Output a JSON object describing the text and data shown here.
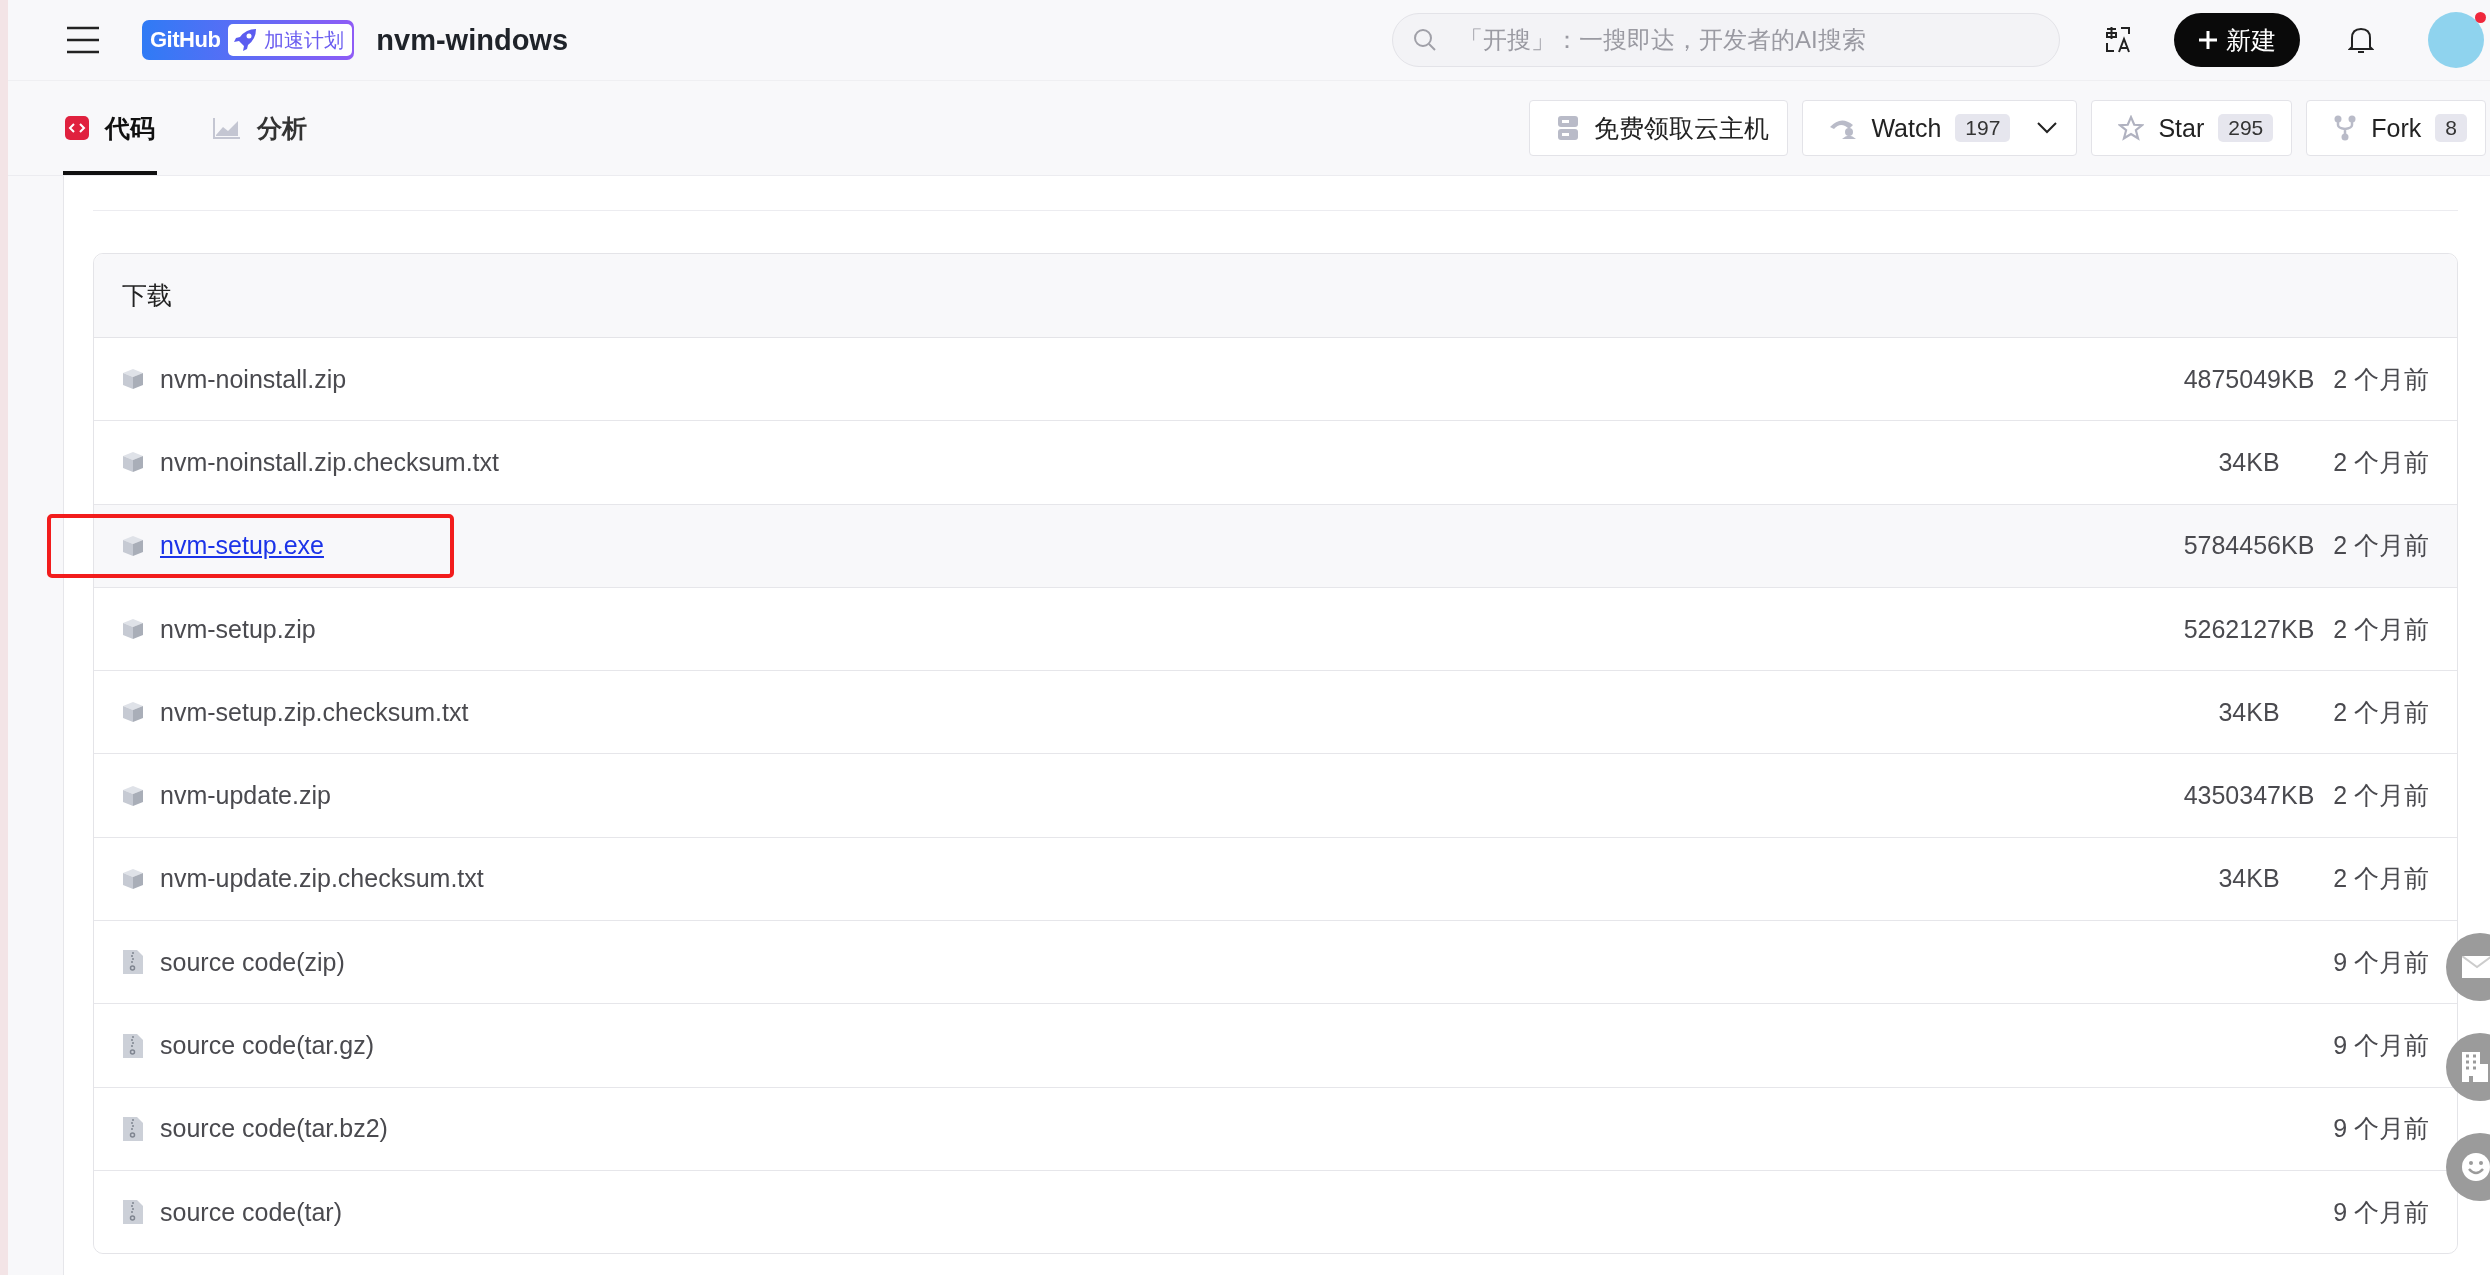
{
  "header": {
    "brand": {
      "logo": "GitHub",
      "program": "加速计划"
    },
    "repo_name": "nvm-windows",
    "search": {
      "placeholder": "「开搜」：一搜即达，开发者的AI搜索"
    },
    "new_button": "新建",
    "has_notification": true
  },
  "tabs": [
    {
      "kind": "code",
      "label": "代码",
      "selected": true
    },
    {
      "kind": "chart",
      "label": "分析",
      "selected": false
    }
  ],
  "actions": [
    {
      "kind": "cloud",
      "label": "免费领取云主机"
    },
    {
      "kind": "watch",
      "label": "Watch",
      "count": "197"
    },
    {
      "kind": "star",
      "label": "Star",
      "count": "295"
    },
    {
      "kind": "fork",
      "label": "Fork",
      "count": "8"
    }
  ],
  "downloads": {
    "title": "下载",
    "files": [
      {
        "kind": "package",
        "name": "nvm-noinstall.zip",
        "size": "4875049KB",
        "age": "2 个月前",
        "hovered": false,
        "annotated": false
      },
      {
        "kind": "package",
        "name": "nvm-noinstall.zip.checksum.txt",
        "size": "34KB",
        "age": "2 个月前",
        "hovered": false,
        "annotated": false
      },
      {
        "kind": "package",
        "name": "nvm-setup.exe",
        "size": "5784456KB",
        "age": "2 个月前",
        "hovered": true,
        "annotated": true
      },
      {
        "kind": "package",
        "name": "nvm-setup.zip",
        "size": "5262127KB",
        "age": "2 个月前",
        "hovered": false,
        "annotated": false
      },
      {
        "kind": "package",
        "name": "nvm-setup.zip.checksum.txt",
        "size": "34KB",
        "age": "2 个月前",
        "hovered": false,
        "annotated": false
      },
      {
        "kind": "package",
        "name": "nvm-update.zip",
        "size": "4350347KB",
        "age": "2 个月前",
        "hovered": false,
        "annotated": false
      },
      {
        "kind": "package",
        "name": "nvm-update.zip.checksum.txt",
        "size": "34KB",
        "age": "2 个月前",
        "hovered": false,
        "annotated": false
      },
      {
        "kind": "archive",
        "name": "source code(zip)",
        "age": "9 个月前",
        "hovered": false,
        "annotated": false
      },
      {
        "kind": "archive",
        "name": "source code(tar.gz)",
        "age": "9 个月前",
        "hovered": false,
        "annotated": false
      },
      {
        "kind": "archive",
        "name": "source code(tar.bz2)",
        "age": "9 个月前",
        "hovered": false,
        "annotated": false
      },
      {
        "kind": "archive",
        "name": "source code(tar)",
        "age": "9 个月前",
        "hovered": false,
        "annotated": false
      }
    ]
  }
}
